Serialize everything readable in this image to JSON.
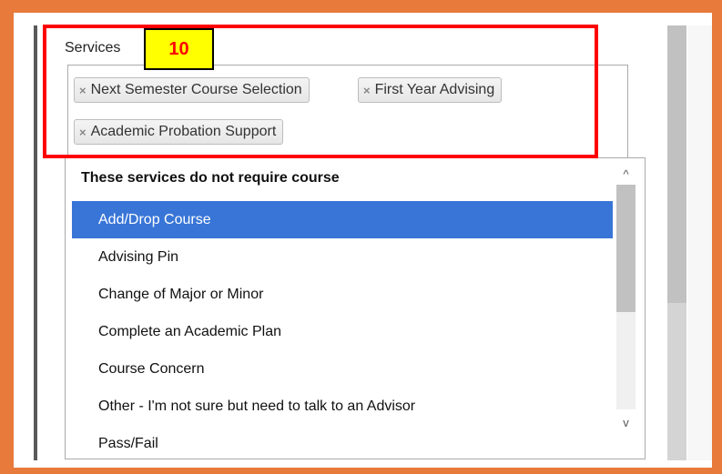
{
  "annotation": {
    "step_badge": "10"
  },
  "field": {
    "label": "Services"
  },
  "selected_chips": [
    {
      "remove_glyph": "×",
      "label": "Next Semester Course Selection"
    },
    {
      "remove_glyph": "×",
      "label": "First Year Advising"
    },
    {
      "remove_glyph": "×",
      "label": "Academic Probation Support"
    }
  ],
  "dropdown": {
    "group_label": "These services do not require course",
    "options": [
      {
        "label": "Add/Drop Course",
        "highlighted": true
      },
      {
        "label": "Advising Pin"
      },
      {
        "label": "Change of Major or Minor"
      },
      {
        "label": "Complete an Academic Plan"
      },
      {
        "label": "Course Concern"
      },
      {
        "label": "Other - I'm not sure but need to talk to an Advisor"
      },
      {
        "label": "Pass/Fail"
      }
    ],
    "scroll_up_glyph": "^",
    "scroll_down_glyph": "v"
  },
  "colors": {
    "frame_orange": "#e87a3b",
    "highlight_blue": "#3875d7",
    "annotation_red": "#ff0000",
    "badge_yellow": "#ffff00"
  }
}
